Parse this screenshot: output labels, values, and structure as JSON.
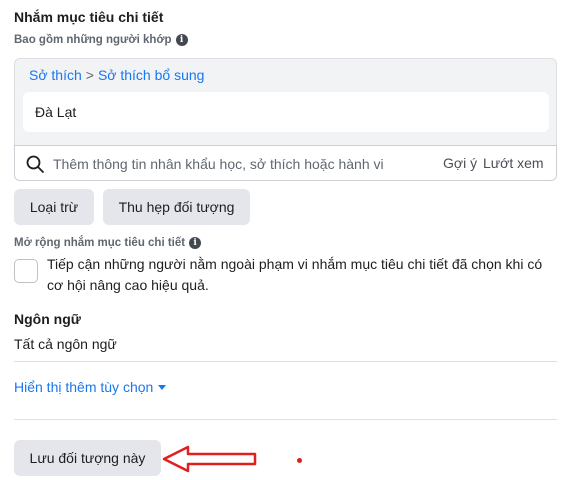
{
  "detailed_targeting": {
    "title": "Nhắm mục tiêu chi tiết",
    "include_label": "Bao gồm những người khớp",
    "info_glyph": "i",
    "breadcrumb": {
      "parent": "Sở thích",
      "separator": ">",
      "child": "Sở thích bổ sung"
    },
    "selected_items": [
      "Đà Lạt"
    ],
    "search": {
      "placeholder": "Thêm thông tin nhân khẩu học, sở thích hoặc hành vi",
      "suggestions_label": "Gợi ý",
      "browse_label": "Lướt xem"
    },
    "exclude_button": "Loại trừ",
    "narrow_button": "Thu hẹp đối tượng"
  },
  "expansion": {
    "label": "Mở rộng nhắm mục tiêu chi tiết",
    "description": "Tiếp cận những người nằm ngoài phạm vi nhắm mục tiêu chi tiết đã chọn khi có cơ hội nâng cao hiệu quả.",
    "checked": false
  },
  "language": {
    "title": "Ngôn ngữ",
    "value": "Tất cả ngôn ngữ"
  },
  "more_options_label": "Hiển thị thêm tùy chọn",
  "save_audience_button": "Lưu đối tượng này",
  "colors": {
    "link": "#1877f2",
    "button_bg": "#e4e6eb",
    "annotation": "#e02020"
  }
}
